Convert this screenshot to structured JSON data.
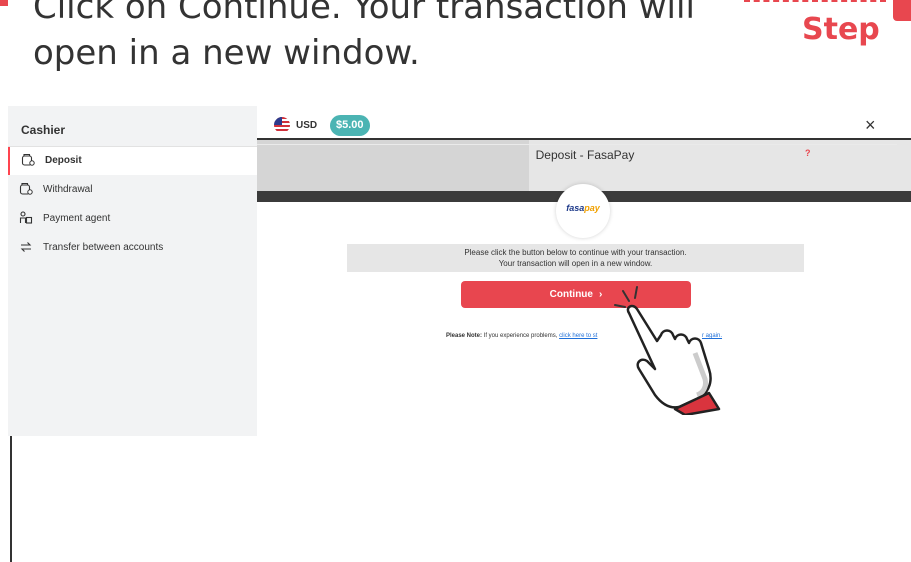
{
  "instruction": {
    "line1": "Click on Continue. Your transaction will",
    "line2": "open in a new window.",
    "step_label": "Step"
  },
  "colors": {
    "accent": "#e8474f",
    "teal_badge": "#4bb4b3",
    "continue_button": "#e8464f"
  },
  "cashier": {
    "title": "Cashier",
    "menu": [
      {
        "label": "Deposit",
        "icon": "wallet-icon",
        "active": true
      },
      {
        "label": "Withdrawal",
        "icon": "wallet-icon",
        "active": false
      },
      {
        "label": "Payment agent",
        "icon": "agent-icon",
        "active": false
      },
      {
        "label": "Transfer between accounts",
        "icon": "transfer-icon",
        "active": false
      }
    ]
  },
  "account": {
    "flag_icon": "us-flag-icon",
    "currency": "USD",
    "balance": "$5.00"
  },
  "deposit": {
    "title": "Deposit - FasaPay",
    "help": "?",
    "logo_text_main": "fasa",
    "logo_text_accent": "pay",
    "info_line1": "Please click the button below to continue with your transaction.",
    "info_line2": "Your transaction will open in a new window.",
    "continue_label": "Continue",
    "continue_chevron": "›",
    "note_label": "Please Note:",
    "note_text": " If you experience problems, ",
    "note_link_left": "click here to st",
    "note_link_right": "r again."
  },
  "close_symbol": "×"
}
